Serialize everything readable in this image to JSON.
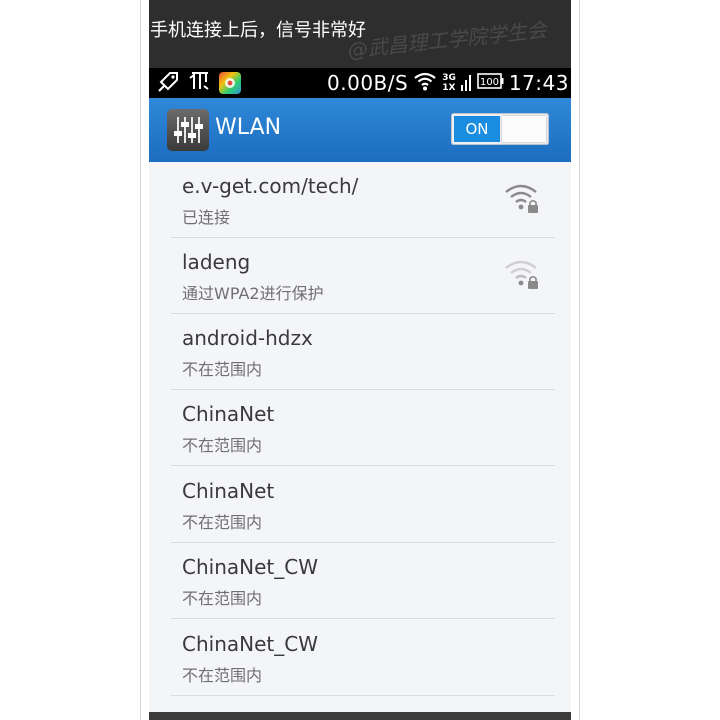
{
  "caption": "手机连接上后，信号非常好",
  "watermark": "@武昌理工学院学生会",
  "status_bar": {
    "speed": "0.00B/S",
    "net_top": "3G",
    "net_bottom": "1X",
    "battery": "100",
    "time": "17:43"
  },
  "action_bar": {
    "title": "WLAN",
    "toggle_label": "ON",
    "toggle_on": true
  },
  "colors": {
    "action_bar": "#1f75c9",
    "toggle_on": "#1a8de0",
    "list_bg": "#f4f5f9"
  },
  "networks": [
    {
      "ssid": "e.v-get.com/tech/",
      "status": "已连接",
      "signal": "strong-lock"
    },
    {
      "ssid": "ladeng",
      "status": "通过WPA2进行保护",
      "signal": "weak-lock"
    },
    {
      "ssid": "android-hdzx",
      "status": "不在范围内"
    },
    {
      "ssid": "ChinaNet",
      "status": "不在范围内"
    },
    {
      "ssid": "ChinaNet",
      "status": "不在范围内"
    },
    {
      "ssid": "ChinaNet_CW",
      "status": "不在范围内"
    },
    {
      "ssid": "ChinaNet_CW",
      "status": "不在范围内"
    }
  ]
}
